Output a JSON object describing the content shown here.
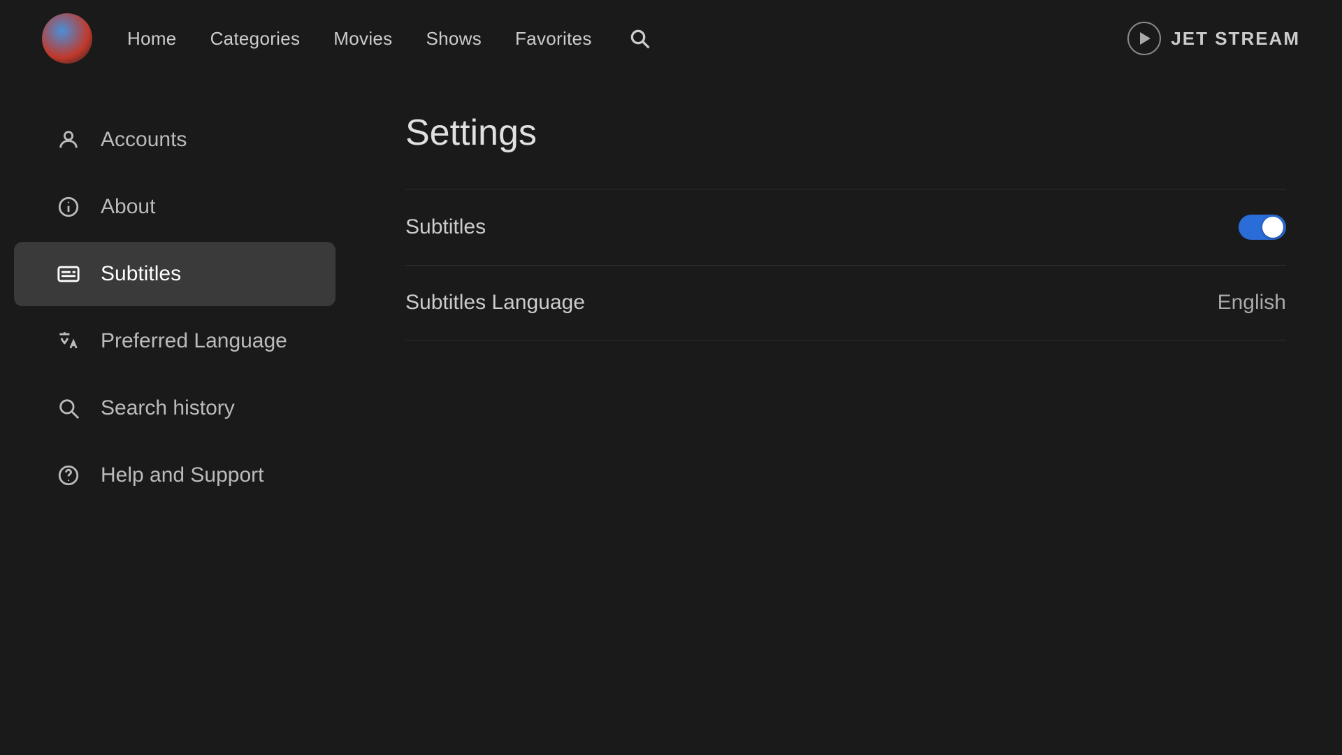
{
  "header": {
    "nav": {
      "home": "Home",
      "categories": "Categories",
      "movies": "Movies",
      "shows": "Shows",
      "favorites": "Favorites"
    },
    "brand": "JET STREAM"
  },
  "sidebar": {
    "items": [
      {
        "id": "accounts",
        "label": "Accounts",
        "icon": "person-icon"
      },
      {
        "id": "about",
        "label": "About",
        "icon": "info-icon"
      },
      {
        "id": "subtitles",
        "label": "Subtitles",
        "icon": "subtitles-icon",
        "active": true
      },
      {
        "id": "preferred-language",
        "label": "Preferred Language",
        "icon": "translate-icon"
      },
      {
        "id": "search-history",
        "label": "Search history",
        "icon": "search-icon"
      },
      {
        "id": "help-support",
        "label": "Help and Support",
        "icon": "help-icon"
      }
    ]
  },
  "settings": {
    "title": "Settings",
    "rows": [
      {
        "id": "subtitles-toggle",
        "label": "Subtitles",
        "type": "toggle",
        "value": true
      },
      {
        "id": "subtitles-language",
        "label": "Subtitles Language",
        "type": "value",
        "value": "English"
      }
    ]
  }
}
